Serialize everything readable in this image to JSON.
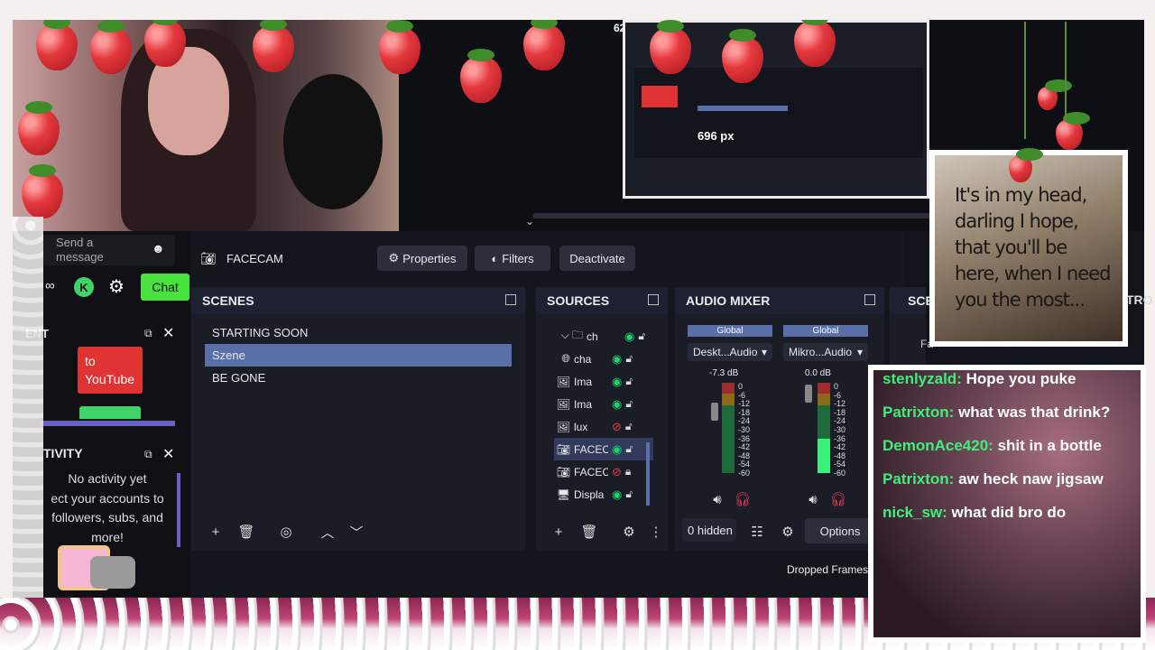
{
  "preview": {
    "counter": "62",
    "width_readout": "696 px"
  },
  "chat_panel": {
    "send_placeholder": "Send a\nmessage",
    "chat_button": "Chat",
    "event_title": "ENT",
    "youtube_text": "to\nYouTube",
    "activity_title": "TIVITY",
    "activity_lines": [
      "No activity yet",
      "ect your accounts to",
      "followers, subs, and",
      "more!"
    ]
  },
  "obs": {
    "source_name": "FACECAM",
    "properties_label": "Properties",
    "filters_label": "Filters",
    "deactivate_label": "Deactivate",
    "scenes": {
      "title": "SCENES",
      "items": [
        {
          "label": "STARTING SOON",
          "selected": false
        },
        {
          "label": "Szene",
          "selected": true
        },
        {
          "label": "BE GONE",
          "selected": false
        }
      ]
    },
    "sources": {
      "title": "SOURCES",
      "items": [
        {
          "label": "ch",
          "icon": "folder-icon",
          "visible": true,
          "locked": false
        },
        {
          "label": "cha",
          "icon": "globe-icon",
          "visible": true,
          "locked": false
        },
        {
          "label": "Ima",
          "icon": "image-icon",
          "visible": true,
          "locked": false
        },
        {
          "label": "Ima",
          "icon": "image-icon",
          "visible": true,
          "locked": false
        },
        {
          "label": "lux",
          "icon": "image-icon",
          "visible": false,
          "locked": false
        },
        {
          "label": "FACEC",
          "icon": "camera-icon",
          "visible": true,
          "locked": false
        },
        {
          "label": "FACEC",
          "icon": "camera-icon",
          "visible": false,
          "locked": true
        },
        {
          "label": "Displa",
          "icon": "monitor-icon",
          "visible": true,
          "locked": false
        }
      ]
    },
    "audio": {
      "title": "AUDIO MIXER",
      "channels": [
        {
          "global": "Global",
          "name": "Deskt...Audio",
          "db": "-7.3 dB"
        },
        {
          "global": "Global",
          "name": "Mikro...Audio",
          "db": "0.0 dB"
        }
      ],
      "scale": [
        "0",
        "-6",
        "-12",
        "-18",
        "-24",
        "-30",
        "-36",
        "-42",
        "-48",
        "-54",
        "-60"
      ],
      "hidden_label": "0 hidden",
      "options_label": "Options"
    },
    "extra_dock_title": "SCE",
    "extra_dock_title2": "TRO",
    "extra_dock_field": "Fa",
    "dropped_frames": "Dropped Frames"
  },
  "quote": {
    "text": "It's in my head, darling I hope, that you'll be here, when I need you the most..."
  },
  "chat_messages": [
    {
      "user": "stenlyzald:",
      "text": "Hope you puke"
    },
    {
      "user": "Patrixton:",
      "text": "what was that drink?"
    },
    {
      "user": "DemonAce420:",
      "text": "shit in a bottle"
    },
    {
      "user": "Patrixton:",
      "text": "aw heck naw jigsaw"
    },
    {
      "user": "nick_sw:",
      "text": "what did bro do"
    }
  ],
  "colors": {
    "accent": "#5a6fa8",
    "chat_green": "#48e23c",
    "username_green": "#3df07a",
    "youtube_red": "#e03434"
  }
}
